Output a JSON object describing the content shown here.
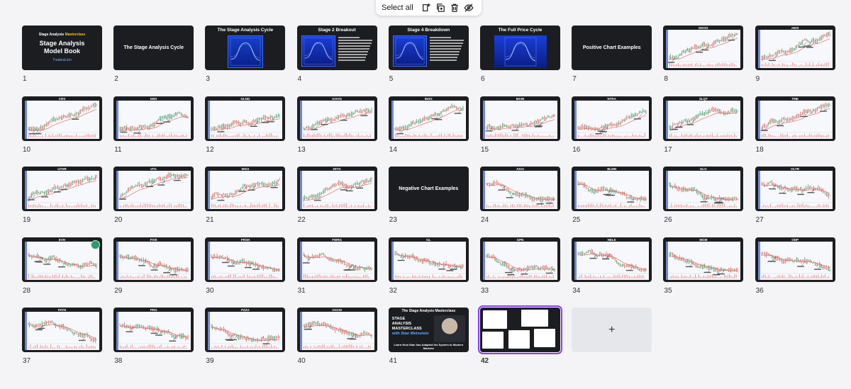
{
  "toolbar": {
    "select_all_label": "Select all",
    "icons": [
      "add-page-icon",
      "duplicate-icon",
      "trash-icon",
      "hide-icon"
    ]
  },
  "pages": [
    {
      "n": "1",
      "kind": "cover",
      "small": "Stage Analysis",
      "small_accent": "Masterclass",
      "title_line1": "Stage Analysis",
      "title_line2": "Model Book",
      "logo": "TradersLion"
    },
    {
      "n": "2",
      "kind": "title",
      "title": "The Stage Analysis Cycle"
    },
    {
      "n": "3",
      "kind": "diagram",
      "title": "The Stage Analysis Cycle"
    },
    {
      "n": "4",
      "kind": "diagram-text",
      "title": "Stage 2 Breakout"
    },
    {
      "n": "5",
      "kind": "diagram-text",
      "title": "Stage 4 Breakdown"
    },
    {
      "n": "6",
      "kind": "diagram-wide",
      "title": "The Full Price Cycle"
    },
    {
      "n": "7",
      "kind": "title",
      "title": "Positive Chart Examples"
    },
    {
      "n": "8",
      "kind": "chart",
      "ticker": "DDOG",
      "trend": "up"
    },
    {
      "n": "9",
      "kind": "chart",
      "ticker": "AEIS",
      "trend": "up"
    },
    {
      "n": "10",
      "kind": "chart",
      "ticker": "CRS",
      "trend": "up"
    },
    {
      "n": "11",
      "kind": "chart",
      "ticker": "EBS",
      "trend": "up"
    },
    {
      "n": "12",
      "kind": "chart",
      "ticker": "GLNG",
      "trend": "up"
    },
    {
      "n": "13",
      "kind": "chart",
      "ticker": "GOOG",
      "trend": "up"
    },
    {
      "n": "14",
      "kind": "chart",
      "ticker": "INSG",
      "trend": "up"
    },
    {
      "n": "15",
      "kind": "chart",
      "ticker": "MAIN",
      "trend": "up"
    },
    {
      "n": "16",
      "kind": "chart",
      "ticker": "NTRA",
      "trend": "up"
    },
    {
      "n": "17",
      "kind": "chart",
      "ticker": "SLQT",
      "trend": "up"
    },
    {
      "n": "18",
      "kind": "chart",
      "ticker": "TME",
      "trend": "up"
    },
    {
      "n": "19",
      "kind": "chart",
      "ticker": "UTHR",
      "trend": "up"
    },
    {
      "n": "20",
      "kind": "chart",
      "ticker": "VITL",
      "trend": "up"
    },
    {
      "n": "21",
      "kind": "chart",
      "ticker": "WGS",
      "trend": "up"
    },
    {
      "n": "22",
      "kind": "chart",
      "ticker": "ZETA",
      "trend": "up"
    },
    {
      "n": "23",
      "kind": "title",
      "title": "Negative Chart Examples"
    },
    {
      "n": "24",
      "kind": "chart",
      "ticker": "ASAI",
      "trend": "down"
    },
    {
      "n": "25",
      "kind": "chart",
      "ticker": "BLMN",
      "trend": "down"
    },
    {
      "n": "26",
      "kind": "chart",
      "ticker": "DLO",
      "trend": "down"
    },
    {
      "n": "27",
      "kind": "chart",
      "ticker": "OLTR",
      "trend": "down"
    },
    {
      "n": "28",
      "kind": "chart",
      "ticker": "EVH",
      "trend": "down",
      "badge": true
    },
    {
      "n": "29",
      "kind": "chart",
      "ticker": "FIVE",
      "trend": "down"
    },
    {
      "n": "30",
      "kind": "chart",
      "ticker": "FRSH",
      "trend": "down"
    },
    {
      "n": "31",
      "kind": "chart",
      "ticker": "FWRG",
      "trend": "down"
    },
    {
      "n": "32",
      "kind": "chart",
      "ticker": "GL",
      "trend": "down"
    },
    {
      "n": "33",
      "kind": "chart",
      "ticker": "GPN",
      "trend": "down"
    },
    {
      "n": "34",
      "kind": "chart",
      "ticker": "HELE",
      "trend": "down"
    },
    {
      "n": "35",
      "kind": "chart",
      "ticker": "MGM",
      "trend": "down"
    },
    {
      "n": "36",
      "kind": "chart",
      "ticker": "ODP",
      "trend": "down"
    },
    {
      "n": "37",
      "kind": "chart",
      "ticker": "PATH",
      "trend": "down"
    },
    {
      "n": "38",
      "kind": "chart",
      "ticker": "PRO",
      "trend": "down"
    },
    {
      "n": "39",
      "kind": "chart",
      "ticker": "PZZA",
      "trend": "down"
    },
    {
      "n": "40",
      "kind": "chart",
      "ticker": "OXCM",
      "trend": "down"
    },
    {
      "n": "41",
      "kind": "masterclass",
      "top": "The Stage Analysis Masterclass",
      "line1": "STAGE",
      "line2": "ANALYSIS",
      "line3": "MASTERCLASS",
      "line4": "with Stan Weinstein",
      "bottom": "Learn How Stan has Adapted his System to Modern Markets"
    },
    {
      "n": "42",
      "kind": "tweets",
      "selected": true
    }
  ],
  "add_page_label": "+",
  "colors": {
    "accent": "#8b3dff",
    "thumb_bg": "#1c1d21",
    "chart_blue": "#6f88d8"
  }
}
